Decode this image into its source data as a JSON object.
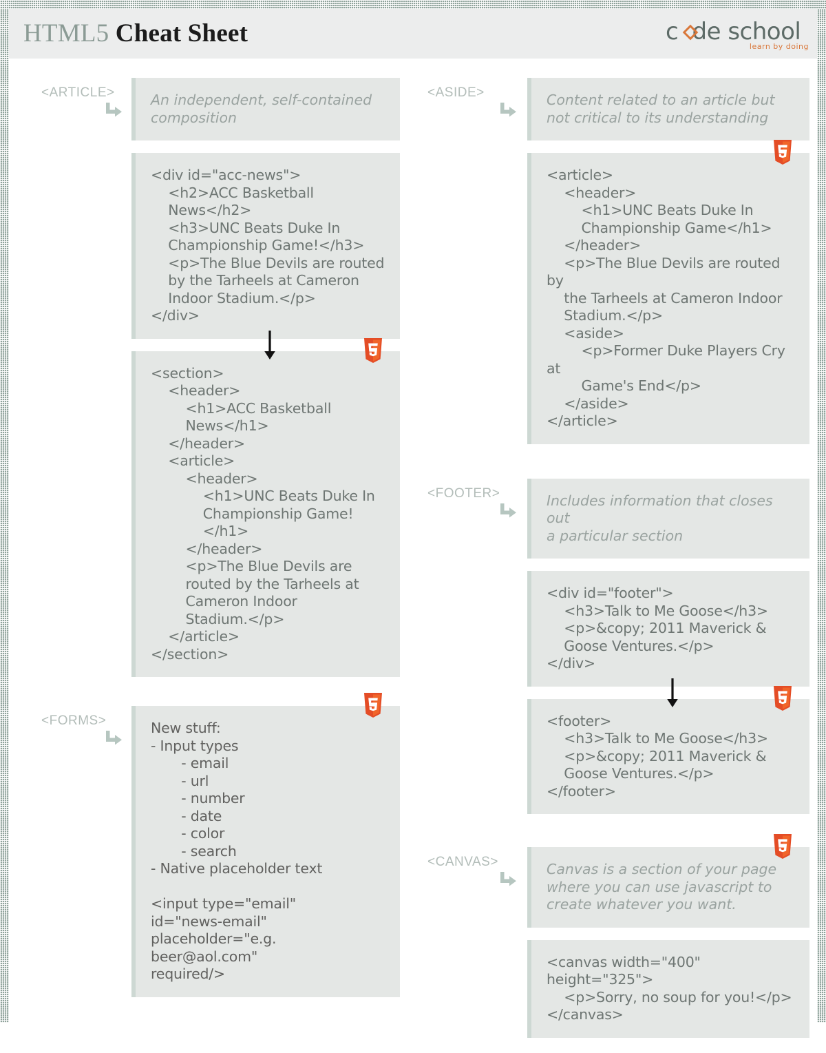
{
  "header": {
    "title_primary": "HTML5",
    "title_secondary": "Cheat Sheet",
    "logo": {
      "word_pre": "c",
      "word_post": "de school",
      "tagline": "learn by doing",
      "accent_color": "#d9773a",
      "word_color": "#5d6b67"
    }
  },
  "colors": {
    "box_bg": "#e4e7e5",
    "box_accent": "#cdd8d3",
    "label": "#b3bdb9",
    "desc_text": "#9aa3a0",
    "code_text": "#6e7673",
    "html5_badge": "#e44d26",
    "header_bg": "#eceded",
    "page_border": "#8fa39b"
  },
  "left_column": [
    {
      "label": "<ARTICLE>",
      "description": "An independent, self-contained\ncomposition",
      "blocks": [
        {
          "kind": "code",
          "badge": false,
          "arrow_before": false,
          "text": "<div id=\"acc-news\">\n    <h2>ACC Basketball\n    News</h2>\n    <h3>UNC Beats Duke In\n    Championship Game!</h3>\n    <p>The Blue Devils are routed\n    by the Tarheels at Cameron\n    Indoor Stadium.</p>\n</div>"
        },
        {
          "kind": "code",
          "badge": true,
          "arrow_before": true,
          "text": "<section>\n    <header>\n        <h1>ACC Basketball\n        News</h1>\n    </header>\n    <article>\n        <header>\n            <h1>UNC Beats Duke In\n            Championship Game!\n            </h1>\n        </header>\n        <p>The Blue Devils are\n        routed by the Tarheels at\n        Cameron Indoor\n        Stadium.</p>\n    </article>\n</section>"
        }
      ]
    },
    {
      "label": "<FORMS>",
      "description": null,
      "blocks": [
        {
          "kind": "list",
          "badge": true,
          "arrow_before": false,
          "text": "New stuff:\n- Input types\n       - email\n       - url\n       - number\n       - date\n       - color\n       - search\n- Native placeholder text\n\n<input type=\"email\"\nid=\"news-email\"\nplaceholder=\"e.g. beer@aol.com\"\nrequired/>"
        }
      ]
    }
  ],
  "right_column": [
    {
      "label": "<ASIDE>",
      "description": "Content related to an article but\nnot critical to its understanding",
      "blocks": [
        {
          "kind": "code",
          "badge": true,
          "arrow_before": false,
          "text": "<article>\n    <header>\n        <h1>UNC Beats Duke In\n        Championship Game</h1>\n    </header>\n    <p>The Blue Devils are routed by\n    the Tarheels at Cameron Indoor\n    Stadium.</p>\n    <aside>\n        <p>Former Duke Players Cry at\n        Game's End</p>\n    </aside>\n</article>"
        }
      ]
    },
    {
      "label": "<FOOTER>",
      "description": "Includes information that closes out\na particular section",
      "blocks": [
        {
          "kind": "code",
          "badge": false,
          "arrow_before": false,
          "text": "<div id=\"footer\">\n    <h3>Talk to Me Goose</h3>\n    <p>&copy; 2011 Maverick &\n    Goose Ventures.</p>\n</div>"
        },
        {
          "kind": "code",
          "badge": true,
          "arrow_before": true,
          "text": "<footer>\n    <h3>Talk to Me Goose</h3>\n    <p>&copy; 2011 Maverick &\n    Goose Ventures.</p>\n</footer>"
        }
      ]
    },
    {
      "label": "<CANVAS>",
      "description": "Canvas is a section of your page\nwhere you can use javascript to\ncreate whatever you want.",
      "description_badge": true,
      "blocks": [
        {
          "kind": "code",
          "badge": false,
          "arrow_before": false,
          "text": "<canvas width=\"400\" height=\"325\">\n    <p>Sorry, no soup for you!</p>\n</canvas>"
        }
      ]
    }
  ]
}
